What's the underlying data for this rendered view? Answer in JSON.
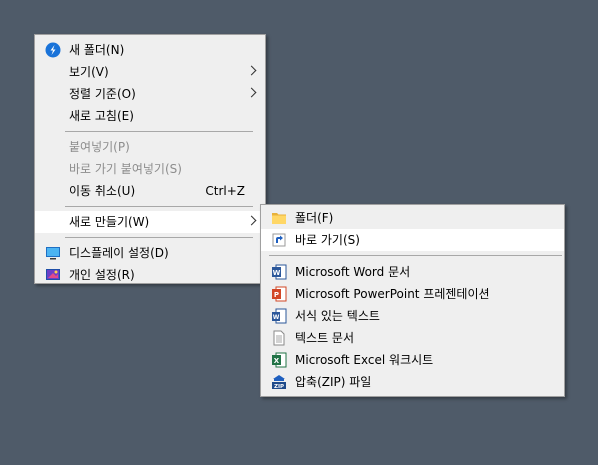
{
  "main_menu": {
    "items": [
      {
        "label": "새 폴더(N)",
        "icon": "new-folder-icon"
      },
      {
        "label": "보기(V)",
        "submenu": true
      },
      {
        "label": "정렬 기준(O)",
        "submenu": true
      },
      {
        "label": "새로 고침(E)"
      },
      {
        "label": "붙여넣기(P)",
        "disabled": true
      },
      {
        "label": "바로 가기 붙여넣기(S)",
        "disabled": true
      },
      {
        "label": "이동 취소(U)",
        "shortcut": "Ctrl+Z"
      },
      {
        "label": "새로 만들기(W)",
        "submenu": true,
        "highlighted": true
      },
      {
        "label": "디스플레이 설정(D)",
        "icon": "display-icon"
      },
      {
        "label": "개인 설정(R)",
        "icon": "personalize-icon"
      }
    ]
  },
  "sub_menu": {
    "items": [
      {
        "label": "폴더(F)",
        "icon": "folder-icon"
      },
      {
        "label": "바로 가기(S)",
        "icon": "shortcut-icon",
        "highlighted": true
      },
      {
        "label": "Microsoft Word 문서",
        "icon": "word-icon"
      },
      {
        "label": "Microsoft PowerPoint 프레젠테이션",
        "icon": "powerpoint-icon"
      },
      {
        "label": "서식 있는 텍스트",
        "icon": "rich-text-icon"
      },
      {
        "label": "텍스트 문서",
        "icon": "text-document-icon"
      },
      {
        "label": "Microsoft Excel 워크시트",
        "icon": "excel-icon"
      },
      {
        "label": "압축(ZIP) 파일",
        "icon": "zip-icon"
      }
    ]
  },
  "colors": {
    "desktop": "#4f5b69",
    "menu_bg": "#efefef",
    "highlight": "#ffffff",
    "disabled_text": "#8d8d8d"
  }
}
